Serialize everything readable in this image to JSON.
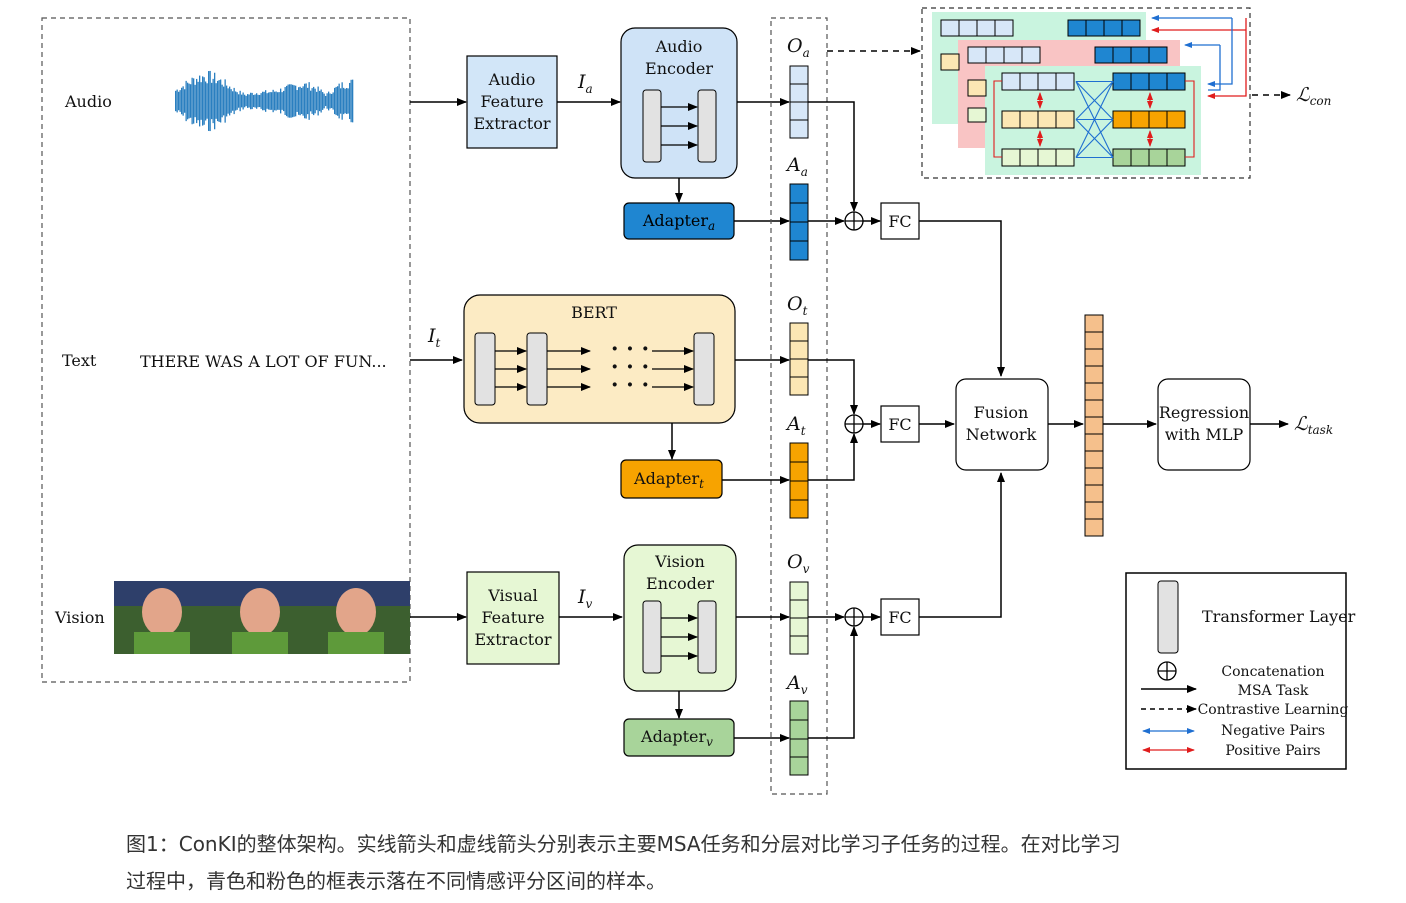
{
  "inputs": {
    "audio_label": "Audio",
    "text_label": "Text",
    "vision_label": "Vision",
    "text_sample": "THERE WAS A LOT OF FUN..."
  },
  "extractors": {
    "audio": [
      "Audio",
      "Feature",
      "Extractor"
    ],
    "visual": [
      "Visual",
      "Feature",
      "Extractor"
    ]
  },
  "encoders": {
    "audio": [
      "Audio",
      "Encoder"
    ],
    "bert": "BERT",
    "vision": [
      "Vision",
      "Encoder"
    ],
    "dots": "· · ·"
  },
  "symbols": {
    "I_a": {
      "main": "I",
      "sub": "a"
    },
    "I_t": {
      "main": "I",
      "sub": "t"
    },
    "I_v": {
      "main": "I",
      "sub": "v"
    },
    "O_a": {
      "main": "O",
      "sub": "a"
    },
    "A_a": {
      "main": "A",
      "sub": "a"
    },
    "O_t": {
      "main": "O",
      "sub": "t"
    },
    "A_t": {
      "main": "A",
      "sub": "t"
    },
    "O_v": {
      "main": "O",
      "sub": "v"
    },
    "A_v": {
      "main": "A",
      "sub": "v"
    }
  },
  "adapters": {
    "audio": {
      "main": "Adapter",
      "sub": "a"
    },
    "text": {
      "main": "Adapter",
      "sub": "t"
    },
    "vision": {
      "main": "Adapter",
      "sub": "v"
    }
  },
  "fc_label": "FC",
  "fusion": [
    "Fusion",
    "Network"
  ],
  "regression": [
    "Regression",
    "with MLP"
  ],
  "losses": {
    "con": {
      "main": "ℒ",
      "sub": "con"
    },
    "task": {
      "main": "ℒ",
      "sub": "task"
    }
  },
  "legend": {
    "transformer_layer": "Transformer Layer",
    "concatenation": "Concatenation",
    "msa_task": "MSA Task",
    "contrastive": "Contrastive Learning",
    "negative_pairs": "Negative Pairs",
    "positive_pairs": "Positive Pairs"
  },
  "colors": {
    "audio_fill": "#1f86d1",
    "audio_light": "#cfe3f7",
    "text_fill": "#f7a300",
    "text_light": "#fcebc4",
    "vision_fill": "#a8d49a",
    "vision_light": "#e6f7d4",
    "fusion_vec": "#f5c08c",
    "negative": "#1f6fd1",
    "positive": "#e01c1c"
  },
  "caption": {
    "line1": "图1：ConKI的整体架构。实线箭头和虚线箭头分别表示主要MSA任务和分层对比学习子任务的过程。在对比学习",
    "line2": "过程中，青色和粉色的框表示落在不同情感评分区间的样本。"
  }
}
